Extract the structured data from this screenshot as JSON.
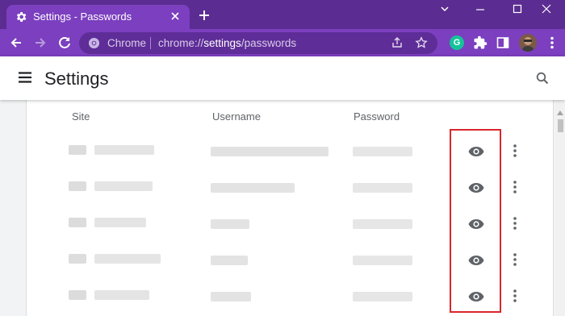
{
  "browser": {
    "tab_title": "Settings - Passwords",
    "omnibox_chrome_label": "Chrome",
    "omnibox_url_prefix": "chrome://",
    "omnibox_url_bold": "settings",
    "omnibox_url_suffix": "/passwords",
    "extension_g_label": "G",
    "colors": {
      "frame": "#5b2c91",
      "toolbar": "#7b3fbf",
      "omnibox": "#5e2d97"
    }
  },
  "settings": {
    "title": "Settings",
    "icons": [
      "menu-icon",
      "search-icon"
    ]
  },
  "passwords": {
    "columns": {
      "site": "Site",
      "username": "Username",
      "password": "Password"
    },
    "row_icons": [
      "eye-icon",
      "more-vert-icon"
    ],
    "rows": [
      {
        "site": "redacted",
        "username": "redacted",
        "password": "redacted"
      },
      {
        "site": "redacted",
        "username": "redacted",
        "password": "redacted"
      },
      {
        "site": "redacted",
        "username": "redacted",
        "password": "redacted"
      },
      {
        "site": "redacted",
        "username": "redacted",
        "password": "redacted"
      },
      {
        "site": "redacted",
        "username": "redacted",
        "password": "redacted"
      }
    ],
    "highlight_color": "#d9262c"
  }
}
